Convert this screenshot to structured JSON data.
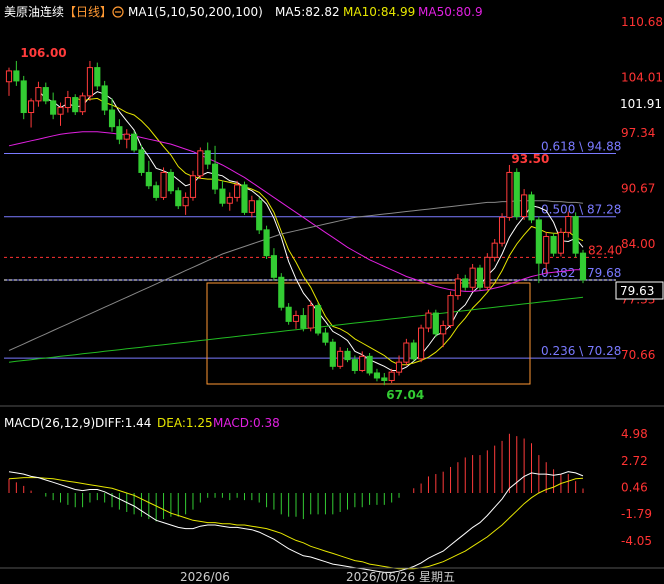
{
  "header": {
    "symbol": "美原油连续",
    "period": "【日线】",
    "ma_label": "MA1(5,10,50,200,100)",
    "ma5": "MA5:82.82",
    "ma10": "MA10:84.99",
    "ma50": "MA50:80.9"
  },
  "macd_header": {
    "label": "MACD(26,12,9)",
    "diff": "DIFF:1.44",
    "dea": "DEA:1.25",
    "macd": "MACD:0.38"
  },
  "colors": {
    "up": "#ff3b3b",
    "down": "#33cc33",
    "ma5": "#ffffff",
    "ma10": "#e6e600",
    "ma50": "#e020e0",
    "ma200": "#888888",
    "ma100": "#22bb22",
    "fib": "#7a7aff",
    "dashed": "#ff3333",
    "box": "#ff9933",
    "axis": "#ff3333"
  },
  "chart_data": [
    {
      "type": "candlestick",
      "title": "美原油连续【日线】",
      "price_axis_ticks": [
        110.68,
        104.01,
        97.34,
        90.67,
        84.0,
        77.33,
        70.66
      ],
      "current_price": "101.91",
      "last_price": "79.63",
      "annotations": {
        "high": "106.00",
        "low": "67.04",
        "swing_high": "93.50",
        "level": "82.40"
      },
      "fib_levels": [
        {
          "label": "0.618 \\ 94.88",
          "value": 94.88
        },
        {
          "label": "0.500 \\ 87.28",
          "value": 87.28
        },
        {
          "label": "0.382 \\ 79.68",
          "value": 79.68
        },
        {
          "label": "0.236 \\ 70.28",
          "value": 70.28
        }
      ],
      "x_labels": [
        "2026/06",
        "2026/06/26 星期五"
      ],
      "ohlc": [
        [
          103.5,
          105.2,
          101.8,
          104.8
        ],
        [
          104.8,
          106.0,
          103.0,
          103.6
        ],
        [
          103.6,
          104.2,
          99.0,
          99.8
        ],
        [
          99.8,
          101.5,
          98.0,
          101.2
        ],
        [
          101.2,
          103.5,
          100.5,
          102.8
        ],
        [
          102.8,
          103.4,
          100.8,
          101.2
        ],
        [
          101.2,
          102.2,
          99.0,
          99.6
        ],
        [
          99.6,
          101.0,
          98.2,
          100.4
        ],
        [
          100.4,
          102.4,
          99.8,
          101.6
        ],
        [
          101.6,
          102.0,
          99.5,
          99.9
        ],
        [
          99.9,
          102.2,
          99.5,
          101.8
        ],
        [
          101.8,
          106.0,
          101.2,
          105.2
        ],
        [
          105.2,
          105.8,
          102.5,
          103.0
        ],
        [
          103.0,
          103.6,
          99.5,
          100.1
        ],
        [
          100.1,
          101.5,
          97.5,
          98.1
        ],
        [
          98.1,
          99.0,
          96.0,
          96.6
        ],
        [
          96.6,
          97.8,
          95.5,
          97.2
        ],
        [
          97.2,
          97.6,
          95.0,
          95.3
        ],
        [
          95.3,
          95.9,
          92.2,
          92.6
        ],
        [
          92.6,
          94.0,
          90.6,
          91.0
        ],
        [
          91.0,
          91.5,
          89.2,
          89.6
        ],
        [
          89.6,
          93.2,
          89.3,
          92.6
        ],
        [
          92.6,
          93.0,
          90.0,
          90.4
        ],
        [
          90.4,
          90.8,
          88.2,
          88.6
        ],
        [
          88.6,
          90.2,
          87.5,
          89.6
        ],
        [
          89.6,
          92.8,
          89.2,
          92.2
        ],
        [
          92.2,
          95.6,
          91.8,
          95.2
        ],
        [
          95.2,
          96.2,
          93.0,
          93.6
        ],
        [
          93.6,
          95.8,
          90.0,
          90.6
        ],
        [
          90.6,
          91.6,
          88.5,
          88.9
        ],
        [
          88.9,
          90.2,
          88.0,
          89.6
        ],
        [
          89.6,
          91.6,
          89.1,
          91.1
        ],
        [
          91.1,
          91.5,
          87.5,
          87.8
        ],
        [
          87.8,
          89.8,
          87.2,
          89.2
        ],
        [
          89.2,
          89.6,
          85.2,
          85.7
        ],
        [
          85.7,
          86.2,
          82.2,
          82.6
        ],
        [
          82.6,
          83.5,
          79.6,
          80.0
        ],
        [
          80.0,
          80.5,
          76.0,
          76.4
        ],
        [
          76.4,
          76.9,
          74.3,
          74.7
        ],
        [
          74.7,
          76.0,
          73.8,
          75.4
        ],
        [
          75.4,
          76.3,
          73.5,
          73.9
        ],
        [
          73.9,
          77.2,
          73.5,
          76.6
        ],
        [
          76.6,
          76.9,
          73.0,
          73.3
        ],
        [
          73.3,
          73.9,
          71.8,
          72.2
        ],
        [
          72.2,
          72.6,
          68.9,
          69.3
        ],
        [
          69.3,
          71.6,
          69.0,
          71.1
        ],
        [
          71.1,
          71.5,
          69.8,
          70.1
        ],
        [
          70.1,
          70.6,
          68.4,
          68.8
        ],
        [
          68.8,
          71.1,
          68.6,
          70.5
        ],
        [
          70.5,
          70.9,
          68.2,
          68.5
        ],
        [
          68.5,
          69.0,
          67.5,
          67.9
        ],
        [
          67.9,
          68.5,
          67.04,
          67.6
        ],
        [
          67.6,
          69.0,
          67.3,
          68.6
        ],
        [
          68.6,
          70.6,
          68.2,
          69.8
        ],
        [
          69.8,
          72.6,
          69.4,
          72.1
        ],
        [
          72.1,
          72.5,
          69.9,
          70.2
        ],
        [
          70.2,
          74.3,
          69.8,
          73.9
        ],
        [
          73.9,
          76.1,
          73.4,
          75.7
        ],
        [
          75.7,
          76.1,
          72.8,
          73.2
        ],
        [
          73.2,
          74.8,
          71.6,
          74.2
        ],
        [
          74.2,
          78.3,
          73.9,
          77.8
        ],
        [
          77.8,
          80.4,
          77.3,
          79.8
        ],
        [
          79.8,
          80.3,
          78.4,
          78.8
        ],
        [
          78.8,
          81.6,
          78.4,
          81.1
        ],
        [
          81.1,
          81.5,
          78.4,
          78.8
        ],
        [
          78.8,
          82.9,
          78.4,
          82.4
        ],
        [
          82.4,
          84.6,
          81.9,
          84.1
        ],
        [
          84.1,
          87.7,
          83.7,
          87.2
        ],
        [
          87.2,
          93.5,
          86.8,
          92.6
        ],
        [
          92.6,
          93.1,
          86.9,
          87.3
        ],
        [
          87.3,
          90.6,
          86.9,
          89.9
        ],
        [
          89.9,
          90.3,
          86.5,
          86.9
        ],
        [
          86.9,
          87.3,
          79.3,
          81.7
        ],
        [
          81.7,
          85.4,
          80.5,
          84.9
        ],
        [
          84.9,
          85.3,
          82.5,
          82.9
        ],
        [
          82.9,
          85.9,
          82.5,
          85.4
        ],
        [
          85.4,
          87.9,
          84.8,
          87.3
        ],
        [
          87.3,
          87.8,
          82.4,
          82.9
        ],
        [
          82.9,
          83.3,
          79.3,
          79.7
        ]
      ],
      "ma_series": [
        {
          "name": "MA5",
          "values": [
            null,
            null,
            null,
            null,
            102.4,
            101.5,
            101.1,
            100.4,
            100.9,
            100.5,
            100.6,
            101.7,
            102.3,
            102.0,
            101.4,
            99.9,
            98.8,
            97.7,
            95.7,
            94.5,
            93.1,
            92.8,
            92.4,
            91.7,
            91.0,
            91.3,
            92.2,
            92.6,
            92.4,
            92.2,
            91.6,
            91.4,
            90.8,
            90.4,
            89.7,
            88.8,
            87.1,
            84.8,
            81.9,
            79.8,
            78.1,
            77.0,
            75.8,
            74.7,
            73.5,
            73.0,
            72.4,
            71.1,
            70.7,
            70.1,
            69.7,
            69.3,
            68.8,
            68.8,
            69.2,
            69.9,
            70.7,
            71.8,
            73.0,
            73.4,
            74.2,
            75.9,
            76.7,
            78.2,
            79.0,
            80.2,
            81.1,
            82.8,
            84.8,
            86.2,
            87.3,
            88.6,
            88.4,
            88.0,
            86.6,
            84.4,
            84.3,
            84.7,
            83.6
          ],
          "extra": []
        },
        {
          "name": "MA10",
          "values": [
            null,
            null,
            null,
            null,
            null,
            null,
            null,
            null,
            null,
            101.6,
            101.2,
            101.4,
            101.5,
            101.0,
            100.7,
            100.3,
            99.8,
            99.5,
            98.8,
            97.9,
            96.8,
            95.7,
            94.7,
            93.3,
            92.5,
            92.1,
            91.9,
            91.8,
            91.8,
            91.6,
            91.4,
            91.2,
            90.9,
            90.6,
            90.2,
            89.3,
            87.8,
            85.5,
            83.3,
            81.8,
            80.1,
            78.8,
            77.0,
            75.3,
            74.1,
            73.8,
            73.3,
            72.6,
            72.1,
            71.6,
            71.1,
            70.6,
            69.9,
            69.5,
            69.5,
            69.7,
            70.0,
            70.4,
            71.0,
            71.8,
            72.8,
            74.1,
            75.1,
            76.3,
            77.2,
            78.2,
            79.3,
            80.8,
            82.6,
            84.0,
            85.1,
            86.1,
            85.8,
            85.4,
            85.3,
            85.3,
            85.5,
            84.8,
            84.4
          ]
        },
        {
          "name": "MA50",
          "values": [
            95.8,
            96.0,
            96.2,
            96.4,
            96.6,
            96.8,
            97.0,
            97.2,
            97.3,
            97.4,
            97.5,
            97.5,
            97.5,
            97.4,
            97.3,
            97.2,
            97.1,
            97.0,
            96.8,
            96.6,
            96.4,
            96.2,
            96.0,
            95.7,
            95.4,
            95.1,
            94.7,
            94.3,
            93.9,
            93.5,
            93.0,
            92.5,
            92.0,
            91.4,
            90.8,
            90.2,
            89.6,
            89.0,
            88.4,
            87.8,
            87.2,
            86.6,
            86.0,
            85.4,
            84.8,
            84.2,
            83.6,
            83.1,
            82.6,
            82.1,
            81.7,
            81.3,
            80.9,
            80.5,
            80.1,
            79.8,
            79.5,
            79.2,
            78.9,
            78.7,
            78.5,
            78.4,
            78.3,
            78.3,
            78.4,
            78.5,
            78.7,
            78.9,
            79.2,
            79.5,
            79.8,
            80.1,
            80.3,
            80.5,
            80.6,
            80.7,
            80.8,
            80.9,
            80.9
          ]
        },
        {
          "name": "MA200",
          "values": [
            71.2,
            71.6,
            72.0,
            72.4,
            72.8,
            73.2,
            73.6,
            74.0,
            74.4,
            74.8,
            75.2,
            75.6,
            76.0,
            76.4,
            76.8,
            77.2,
            77.6,
            78.0,
            78.4,
            78.8,
            79.2,
            79.6,
            80.0,
            80.4,
            80.8,
            81.2,
            81.6,
            82.0,
            82.4,
            82.8,
            83.1,
            83.4,
            83.7,
            84.0,
            84.3,
            84.6,
            84.9,
            85.2,
            85.4,
            85.6,
            85.8,
            86.0,
            86.2,
            86.4,
            86.6,
            86.8,
            87.0,
            87.2,
            87.3,
            87.4,
            87.5,
            87.6,
            87.7,
            87.8,
            87.9,
            88.0,
            88.1,
            88.2,
            88.3,
            88.4,
            88.5,
            88.6,
            88.7,
            88.8,
            88.9,
            89.0,
            89.0,
            89.1,
            89.1,
            89.2,
            89.2,
            89.2,
            89.2,
            89.2,
            89.1,
            89.1,
            89.0,
            89.0,
            88.9
          ]
        },
        {
          "name": "MA100",
          "values": [
            69.8,
            69.9,
            70.0,
            70.1,
            70.2,
            70.3,
            70.4,
            70.5,
            70.6,
            70.7,
            70.8,
            70.9,
            71.0,
            71.1,
            71.2,
            71.3,
            71.4,
            71.5,
            71.6,
            71.7,
            71.8,
            71.9,
            72.0,
            72.1,
            72.2,
            72.3,
            72.4,
            72.5,
            72.6,
            72.7,
            72.8,
            72.9,
            73.0,
            73.1,
            73.2,
            73.3,
            73.4,
            73.5,
            73.6,
            73.7,
            73.8,
            73.9,
            74.0,
            74.1,
            74.2,
            74.3,
            74.4,
            74.5,
            74.6,
            74.7,
            74.8,
            74.9,
            75.0,
            75.1,
            75.2,
            75.3,
            75.4,
            75.5,
            75.6,
            75.7,
            75.8,
            75.9,
            76.0,
            76.1,
            76.2,
            76.3,
            76.4,
            76.5,
            76.6,
            76.7,
            76.8,
            76.9,
            77.0,
            77.1,
            77.2,
            77.3,
            77.4,
            77.5,
            77.6
          ]
        }
      ]
    },
    {
      "type": "macd",
      "title": "MACD(26,12,9)",
      "y_ticks": [
        4.98,
        2.72,
        0.46,
        -1.79,
        -4.05
      ],
      "diff": [
        1.8,
        1.7,
        1.6,
        1.4,
        1.3,
        1.1,
        0.9,
        0.7,
        0.5,
        0.3,
        0.2,
        0.3,
        0.3,
        0.1,
        -0.2,
        -0.5,
        -0.8,
        -1.1,
        -1.5,
        -1.9,
        -2.3,
        -2.5,
        -2.7,
        -2.9,
        -3.0,
        -3.0,
        -2.8,
        -2.7,
        -2.7,
        -2.8,
        -2.9,
        -2.9,
        -3.0,
        -3.1,
        -3.3,
        -3.6,
        -3.9,
        -4.3,
        -4.7,
        -5.0,
        -5.3,
        -5.4,
        -5.6,
        -5.8,
        -6.0,
        -6.1,
        -6.2,
        -6.3,
        -6.4,
        -6.5,
        -6.6,
        -6.7,
        -6.7,
        -6.6,
        -6.4,
        -6.2,
        -5.9,
        -5.5,
        -5.2,
        -4.9,
        -4.4,
        -3.9,
        -3.4,
        -2.9,
        -2.5,
        -1.9,
        -1.2,
        -0.5,
        0.4,
        0.9,
        1.4,
        1.7,
        1.6,
        1.6,
        1.5,
        1.6,
        1.8,
        1.7,
        1.44
      ],
      "dea": [
        1.2,
        1.25,
        1.3,
        1.3,
        1.3,
        1.25,
        1.2,
        1.1,
        1.0,
        0.9,
        0.8,
        0.7,
        0.6,
        0.5,
        0.4,
        0.2,
        0.0,
        -0.2,
        -0.5,
        -0.8,
        -1.1,
        -1.4,
        -1.7,
        -1.9,
        -2.1,
        -2.3,
        -2.4,
        -2.5,
        -2.5,
        -2.6,
        -2.6,
        -2.7,
        -2.7,
        -2.8,
        -2.9,
        -3.0,
        -3.2,
        -3.4,
        -3.7,
        -4.0,
        -4.2,
        -4.5,
        -4.7,
        -4.9,
        -5.1,
        -5.3,
        -5.5,
        -5.7,
        -5.8,
        -6.0,
        -6.1,
        -6.2,
        -6.3,
        -6.4,
        -6.4,
        -6.4,
        -6.3,
        -6.2,
        -6.0,
        -5.8,
        -5.5,
        -5.2,
        -4.9,
        -4.5,
        -4.1,
        -3.7,
        -3.2,
        -2.7,
        -2.1,
        -1.5,
        -0.9,
        -0.4,
        0.0,
        0.3,
        0.5,
        0.8,
        1.0,
        1.2,
        1.25
      ],
      "macd_hist": [
        1.2,
        0.9,
        0.6,
        0.2,
        0.0,
        -0.3,
        -0.6,
        -0.8,
        -1.0,
        -1.2,
        -1.2,
        -0.8,
        -0.6,
        -0.8,
        -1.2,
        -1.4,
        -1.6,
        -1.8,
        -2.0,
        -2.2,
        -2.4,
        -2.2,
        -2.0,
        -2.0,
        -1.8,
        -1.4,
        -0.8,
        -0.4,
        -0.4,
        -0.4,
        -0.6,
        -0.4,
        -0.6,
        -0.6,
        -0.8,
        -1.2,
        -1.4,
        -1.8,
        -2.0,
        -2.0,
        -2.2,
        -1.8,
        -1.8,
        -1.8,
        -1.8,
        -1.6,
        -1.4,
        -1.2,
        -1.2,
        -1.0,
        -1.0,
        -1.0,
        -0.8,
        -0.4,
        0.0,
        0.4,
        0.8,
        1.4,
        1.6,
        1.8,
        2.2,
        2.6,
        3.0,
        3.2,
        3.2,
        3.6,
        4.0,
        4.4,
        5.0,
        4.8,
        4.6,
        4.2,
        3.2,
        2.6,
        2.0,
        1.6,
        1.6,
        1.0,
        0.38
      ]
    }
  ]
}
